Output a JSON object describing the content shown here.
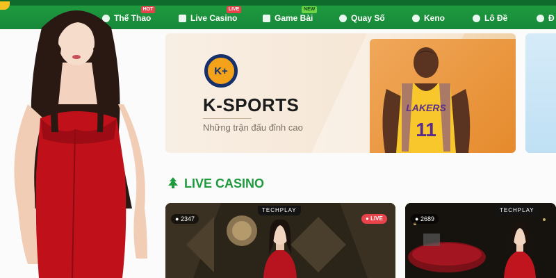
{
  "nav": {
    "items": [
      {
        "label": "Thể Thao",
        "badge": "HOT"
      },
      {
        "label": "Live Casino",
        "badge": "LIVE"
      },
      {
        "label": "Game Bài",
        "badge": "NEW"
      },
      {
        "label": "Quay Số",
        "badge": ""
      },
      {
        "label": "Keno",
        "badge": ""
      },
      {
        "label": "Lô Đề",
        "badge": ""
      },
      {
        "label": "Đ",
        "badge": ""
      }
    ]
  },
  "banner": {
    "logo_text": "K+",
    "title": "K-SPORTS",
    "subtitle": "Những trận đấu đỉnh cao",
    "jersey_text": "LAKERS",
    "jersey_number": "11"
  },
  "section": {
    "title": "LIVE CASINO"
  },
  "cards": [
    {
      "provider": "TECHPLAY",
      "viewers": "2347",
      "live": "LIVE"
    },
    {
      "provider": "TECHPLAY",
      "viewers": "2689",
      "live": ""
    }
  ],
  "colors": {
    "brand_green": "#1f9a3e",
    "badge_red": "#e8424b",
    "badge_new": "#6ed646"
  }
}
